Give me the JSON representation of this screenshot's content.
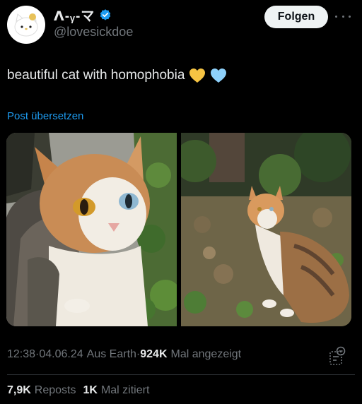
{
  "author": {
    "display_name": "ᐱ-ᵧ-マ",
    "handle": "@lovesickdoe",
    "verified": true
  },
  "header": {
    "follow_label": "Folgen"
  },
  "post": {
    "text": "beautiful cat with homophobia",
    "emoji": [
      "yellow-heart",
      "light-blue-heart"
    ],
    "translate_label": "Post übersetzen"
  },
  "media": {
    "images": [
      "cat-closeup-photo",
      "cat-in-leaves-photo"
    ]
  },
  "meta": {
    "time": "12:38",
    "separator": " · ",
    "date": "04.06.24",
    "location": "Aus Earth",
    "views_count": "924K",
    "views_label": "Mal angezeigt"
  },
  "stats": {
    "reposts_count": "7,9K",
    "reposts_label": "Reposts",
    "quotes_count": "1K",
    "quotes_label": "Mal zitiert"
  },
  "colors": {
    "background": "#000000",
    "link": "#1d9bf0",
    "verified": "#1d9bf0",
    "muted": "#71767b"
  }
}
